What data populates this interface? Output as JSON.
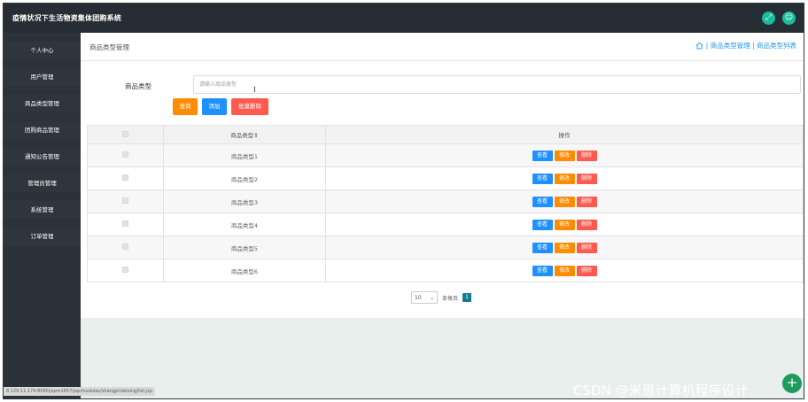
{
  "header": {
    "title": "疫情状况下生活物资集体团购系统",
    "icons": [
      "expand-icon",
      "user-icon"
    ]
  },
  "sidebar": {
    "items": [
      {
        "label": "个人中心"
      },
      {
        "label": "用户管理"
      },
      {
        "label": "商品类型管理"
      },
      {
        "label": "团购商品管理"
      },
      {
        "label": "通知公告管理"
      },
      {
        "label": "管理员管理"
      },
      {
        "label": "系统管理"
      },
      {
        "label": "订单管理"
      }
    ]
  },
  "breadcrumb": {
    "title": "商品类型管理",
    "trail": "| 商品类型管理 | 商品类型列表"
  },
  "search": {
    "label": "商品类型",
    "placeholder": "请输入商品类型",
    "value": ""
  },
  "actions": {
    "query": "查询",
    "add": "添加",
    "batch_delete": "批量删除"
  },
  "table": {
    "headers": [
      "",
      "商品类型⇕",
      "操作"
    ],
    "rows": [
      {
        "type": "商品类型1"
      },
      {
        "type": "商品类型2"
      },
      {
        "type": "商品类型3"
      },
      {
        "type": "商品类型4"
      },
      {
        "type": "商品类型5"
      },
      {
        "type": "商品类型6"
      }
    ],
    "row_buttons": {
      "view": "查看",
      "edit": "修改",
      "delete": "删除"
    }
  },
  "pager": {
    "page_size": "10",
    "per_page_label": "条每页",
    "current_page": "1"
  },
  "status_url": "8.129.11.174:8080/jspm1657/jsp/modules/shangpinleixing/list.jsp",
  "watermark": "CSDN @米恩计算机程序设计",
  "fab_icon": "+",
  "colors": {
    "query": "#ff8c00",
    "add": "#1e90ff",
    "batch_delete": "#ff5a4f",
    "accent": "#1abc9c",
    "topbar": "#262d35"
  }
}
